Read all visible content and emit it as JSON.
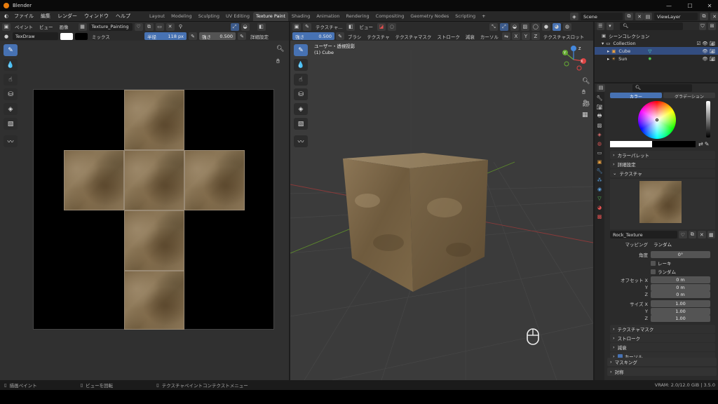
{
  "window": {
    "app_title": "Blender",
    "minimize": "—",
    "maximize": "☐",
    "close": "✕"
  },
  "menu": {
    "items": [
      "ファイル",
      "編集",
      "レンダー",
      "ウィンドウ",
      "ヘルプ"
    ]
  },
  "workspaces": {
    "tabs": [
      "Layout",
      "Modeling",
      "Sculpting",
      "UV Editing",
      "Texture Paint",
      "Shading",
      "Animation",
      "Rendering",
      "Compositing",
      "Geometry Nodes",
      "Scripting"
    ],
    "active": "Texture Paint",
    "add": "+"
  },
  "scene": {
    "label": "Scene",
    "view_layer": "ViewLayer"
  },
  "image_editor": {
    "header": {
      "mode": "ペイント",
      "view": "ビュー",
      "image": "画像",
      "image_name": "Texture_Painting"
    },
    "tool_settings": {
      "brush": "TexDraw",
      "blend": "ミックス",
      "radius_label": "半径",
      "radius_value": "118 px",
      "strength_label": "強さ",
      "strength_value": "0.500",
      "details": "詳細設定"
    }
  },
  "viewport": {
    "header": {
      "mode": "テクスチャ...",
      "view": "ビュー",
      "strength_label": "強さ",
      "strength_value": "0.500",
      "menus": [
        "ブラシ",
        "テクスチャ",
        "テクスチャマスク",
        "ストローク",
        "減衰",
        "カーソル",
        "テクスチャスロット"
      ]
    },
    "overlay": {
      "projection": "ユーザー・透視投影",
      "object": "(1) Cube"
    },
    "axes": {
      "x": "X",
      "y": "Y",
      "z": "Z"
    },
    "symmetry": [
      "X",
      "Y",
      "Z"
    ]
  },
  "outliner": {
    "items": [
      {
        "label": "シーンコレクション",
        "indent": 0
      },
      {
        "label": "Collection",
        "indent": 1
      },
      {
        "label": "Cube",
        "indent": 2,
        "selected": true
      },
      {
        "label": "Sun",
        "indent": 2
      }
    ]
  },
  "properties": {
    "tabs": [
      "カラー",
      "グラデーション"
    ],
    "sections": {
      "palette": "カラーパレット",
      "advanced": "詳細設定",
      "texture": "テクスチャ",
      "texture_mask": "テクスチャマスク",
      "stroke": "ストローク",
      "falloff": "減衰",
      "cursor": "カーソル",
      "masking": "マスキング",
      "symmetry": "対称"
    },
    "texture": {
      "name": "Rock_Texture",
      "mapping_label": "マッピング",
      "mapping_value": "ランダム",
      "angle_label": "角度",
      "angle_value": "0°",
      "rake_label": "レーキ",
      "random_label": "ランダム",
      "offset_label": "オフセット X",
      "offset": {
        "x": "0 m",
        "y": "0 m",
        "z": "0 m"
      },
      "size_label": "サイズ X",
      "size": {
        "x": "1.00",
        "y": "1.00",
        "z": "1.00"
      },
      "y_label": "Y",
      "z_label": "Z"
    }
  },
  "status": {
    "left": "描画ペイント",
    "middle": "ビューを回転",
    "right": "テクスチャペイントコンテクストメニュー",
    "vram": "VRAM: 2.0/12.0 GiB | 3.5.0"
  },
  "colors": {
    "accent": "#4772b3",
    "selection": "#334d80",
    "brand": "#e87d0d"
  }
}
